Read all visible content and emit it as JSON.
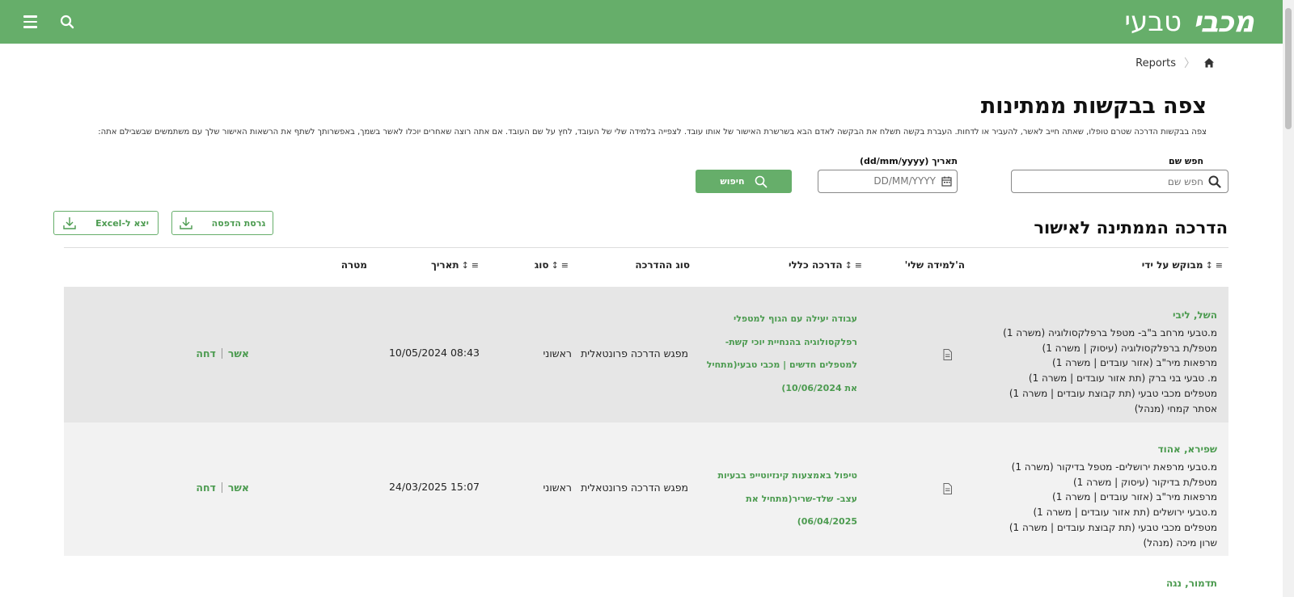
{
  "header": {
    "logo_main": "מכבי",
    "logo_sub": "טבעי",
    "colors": {
      "brand": "#66ae6a",
      "link": "#4c9b50"
    }
  },
  "breadcrumb": {
    "home_icon": "home-icon",
    "current": "Reports"
  },
  "page": {
    "title": "צפה בבקשות ממתינות",
    "description": "צפה בבקשות הדרכה שטרם טופלו, שאתה חייב לאשר, להעביר או לדחות. העברת בקשה תשלח את הבקשה לאדם הבא בשרשרת האישור של אותו עובד. לצפייה בלמידה שלי של העובד, לחץ על שם העובד. אם אתה רוצה שאחרים יוכלו לאשר בשמך, באפשרותך לשתף את הרשאות האישור שלך עם משתמשים שבשבילם אתה:"
  },
  "filters": {
    "name_label": "חפש שם",
    "name_placeholder": "חפש שם",
    "date_label": "תאריך (dd/mm/yyyy)",
    "date_placeholder": "DD/MM/YYYY",
    "search_button": "חיפוש"
  },
  "section": {
    "title": "הדרכה הממתינה לאישור",
    "print_button": "גרסת הדפסה",
    "excel_button": "יצא ל-Excel"
  },
  "table": {
    "headers": {
      "requested_by": "מבוקש על ידי",
      "my_learning": "ה'למידה שלי'",
      "course": "הדרכה כללי",
      "course_type": "סוג ההדרכה",
      "type": "סוג",
      "date": "תאריך",
      "goal": "מטרה"
    },
    "approve_label": "אשר",
    "reject_label": "דחה",
    "rows": [
      {
        "name": "השל, ליבי",
        "lines": [
          "מ.טבעי מרחב ב\"ב- מטפל ברפלקסולוגיה (משרה 1)",
          "מטפל/ת ברפלקסולוגיה (עיסוק | משרה 1)",
          "מרפאות מיר\"ב (אזור עובדים | משרה 1)",
          "מ. טבעי בני ברק (תת אזור עובדים | משרה 1)",
          "מטפלים מכבי טבעי (תת קבוצת עובדים | משרה 1)",
          "אסתר קמחי (מנהל)"
        ],
        "course": "עבודה יעילה עם הגוף למטפלי רפלקסולוגיה בהנחיית יוכי קשת- למטפלים חדשים | מכבי טבעי(מתחיל את 10/06/2024)",
        "course_type": "מפגש הדרכה פרונטאלית",
        "type": "ראשוני",
        "date": "10/05/2024 08:43"
      },
      {
        "name": "שפירא, אהוד",
        "lines": [
          "מ.טבעי מרפאת ירושלים- מטפל בדיקור (משרה 1)",
          "מטפל/ת בדיקור (עיסוק | משרה 1)",
          "מרפאות מיר\"ב (אזור עובדים | משרה 1)",
          "מ.טבעי ירושלים (תת אזור עובדים | משרה 1)",
          "מטפלים מכבי טבעי (תת קבוצת עובדים | משרה 1)",
          "שרון מיכה (מנהל)"
        ],
        "course": "טיפול באמצעות קינזיוטייפ בבעיות עצב- שלד-שריר(מתחיל את 06/04/2025)",
        "course_type": "מפגש הדרכה פרונטאלית",
        "type": "ראשוני",
        "date": "24/03/2025 15:07"
      },
      {
        "name": "תדמור, נגה"
      }
    ]
  }
}
